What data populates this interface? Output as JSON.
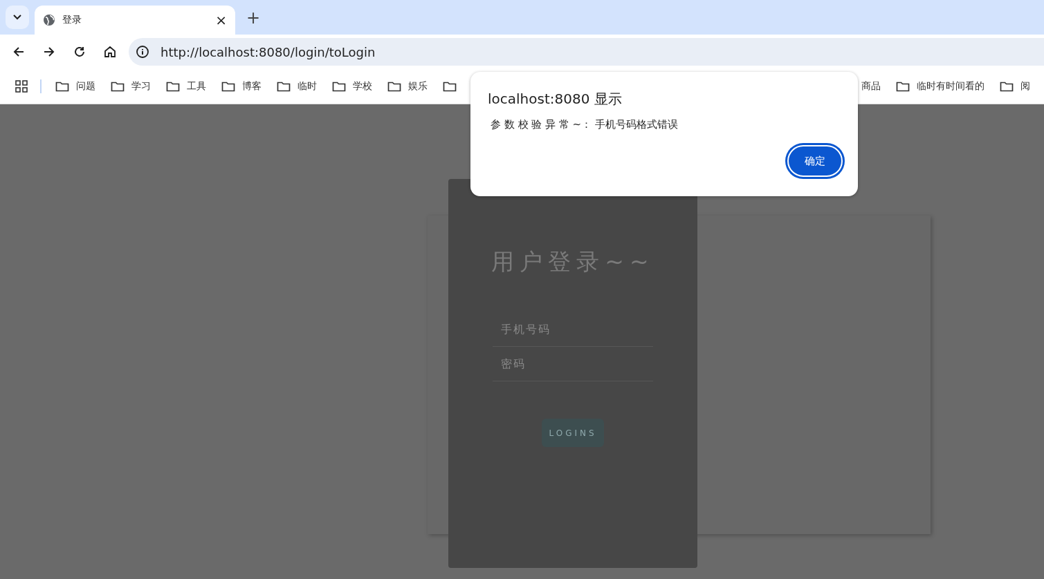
{
  "browser": {
    "tab": {
      "title": "登录",
      "close": "×"
    },
    "new_tab": "+",
    "address": "http://localhost:8080/login/toLogin"
  },
  "bookmarks_left": [
    {
      "label": "问题"
    },
    {
      "label": "学习"
    },
    {
      "label": "工具"
    },
    {
      "label": "博客"
    },
    {
      "label": "临时"
    },
    {
      "label": "学校"
    },
    {
      "label": "娱乐"
    }
  ],
  "bookmarks_right": [
    {
      "label": "商品",
      "icon": false
    },
    {
      "label": "临时有时间看的",
      "icon": true
    },
    {
      "label": "阅",
      "icon": true
    }
  ],
  "login": {
    "title": "用户登录~~",
    "fields": [
      {
        "placeholder": "手机号码"
      },
      {
        "placeholder": "密码"
      }
    ],
    "button": "LOGINS"
  },
  "dialog": {
    "title": "localhost:8080 显示",
    "message": "参 数 校 验 异 常 ~： 手机号码格式错误",
    "button": "确定"
  }
}
